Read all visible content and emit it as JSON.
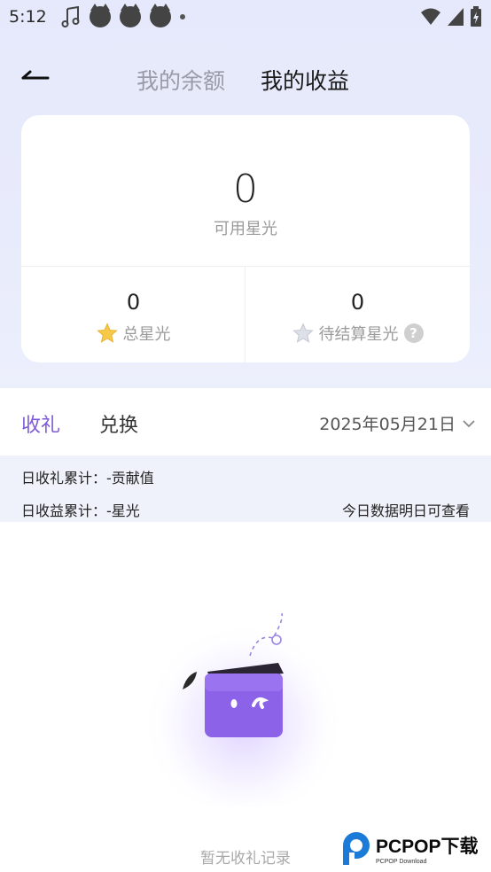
{
  "status_bar": {
    "time": "5:12",
    "left_icons": [
      "music-note-icon",
      "cat-notification-icon",
      "cat-notification-icon",
      "cat-notification-icon",
      "dot-icon"
    ],
    "right_icons": [
      "wifi-icon",
      "signal-icon",
      "battery-charging-icon"
    ]
  },
  "nav": {
    "back_icon": "back-arrow-icon",
    "tabs": [
      {
        "label": "我的余额",
        "active": false
      },
      {
        "label": "我的收益",
        "active": true
      }
    ]
  },
  "summary": {
    "available_value": "0",
    "available_label": "可用星光",
    "total_value": "0",
    "total_label": "总星光",
    "total_icon": "gold-star-icon",
    "pending_value": "0",
    "pending_label": "待结算星光",
    "pending_icon": "gray-star-icon",
    "help_icon": "question-icon"
  },
  "tabs": [
    {
      "label": "收礼",
      "active": true
    },
    {
      "label": "兑换",
      "active": false
    }
  ],
  "date_filter": {
    "value": "2025年05月21日",
    "icon": "chevron-down-icon"
  },
  "info": {
    "gift_total": "日收礼累计：-贡献值",
    "income_total": "日收益累计：-星光",
    "note": "今日数据明日可查看"
  },
  "empty_state": {
    "text": "暂无收礼记录",
    "illustration": "purple-box-mascot-icon"
  },
  "watermark": {
    "brand": "PCPOP下载",
    "sub": "PCPOP Download"
  },
  "colors": {
    "accent": "#7e5bd6",
    "header_bg": "#e6e9fb",
    "info_bg": "#f0f2fb",
    "star_gold": "#f7c948"
  }
}
